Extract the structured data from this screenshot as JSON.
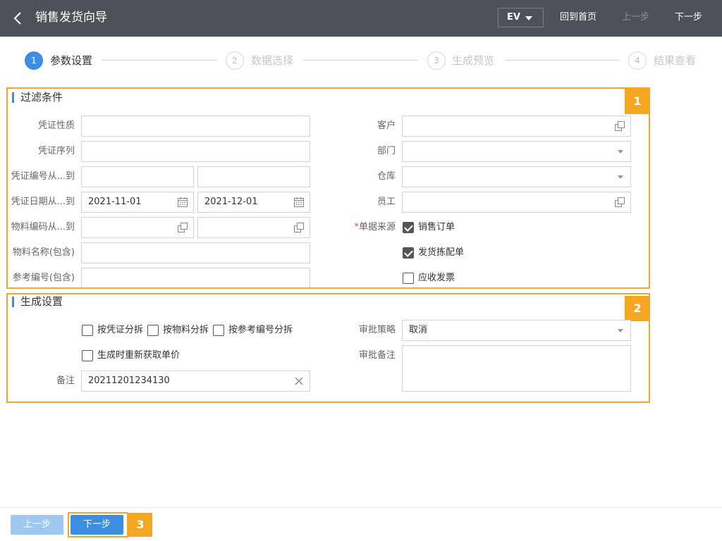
{
  "header": {
    "title": "销售发货向导",
    "ev_label": "EV",
    "home_label": "回到首页",
    "prev_label": "上一步",
    "next_label": "下一步"
  },
  "steps": [
    {
      "num": "1",
      "label": "参数设置",
      "active": true
    },
    {
      "num": "2",
      "label": "数据选择",
      "active": false
    },
    {
      "num": "3",
      "label": "生成预览",
      "active": false
    },
    {
      "num": "4",
      "label": "结果查看",
      "active": false
    }
  ],
  "filter": {
    "title": "过滤条件",
    "badge": "1",
    "labels": {
      "voucher_type": "凭证性质",
      "voucher_seq": "凭证序列",
      "voucher_no_range": "凭证编号从...到",
      "voucher_date_range": "凭证日期从...到",
      "item_code_range": "物料编码从...到",
      "item_name": "物料名称(包含)",
      "ref_no": "参考编号(包含)",
      "customer": "客户",
      "department": "部门",
      "warehouse": "仓库",
      "employee": "员工",
      "source_required": "*",
      "source": "单据来源"
    },
    "values": {
      "date_from": "2021-11-01",
      "date_to": "2021-12-01"
    },
    "sources": [
      {
        "label": "销售订单",
        "checked": true
      },
      {
        "label": "发货拣配单",
        "checked": true
      },
      {
        "label": "应收发票",
        "checked": false
      }
    ]
  },
  "generate": {
    "title": "生成设置",
    "badge": "2",
    "split_options": [
      {
        "label": "按凭证分拆",
        "checked": false
      },
      {
        "label": "按物料分拆",
        "checked": false
      },
      {
        "label": "按参考编号分拆",
        "checked": false
      }
    ],
    "reprice": {
      "label": "生成时重新获取单价",
      "checked": false
    },
    "remark_label": "备注",
    "remark_value": "20211201234130",
    "approval_policy_label": "审批策略",
    "approval_policy_value": "取消",
    "approval_note_label": "审批备注"
  },
  "footer": {
    "prev_label": "上一步",
    "next_label": "下一步",
    "badge": "3"
  },
  "colors": {
    "header_bg": "#4d5259",
    "accent": "#3d8ee0",
    "highlight": "#f5a623"
  }
}
